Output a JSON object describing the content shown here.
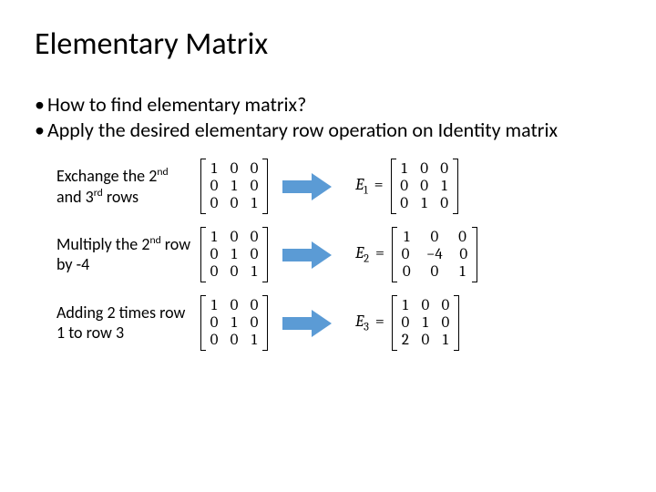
{
  "title": "Elementary Matrix",
  "bullets": [
    "How to find elementary matrix?",
    "Apply the desired elementary row operation on Identity matrix"
  ],
  "examples": [
    {
      "desc_parts": [
        "Exchange the 2",
        "nd",
        " and 3",
        "rd",
        " rows"
      ],
      "identity": [
        [
          "1",
          "0",
          "0"
        ],
        [
          "0",
          "1",
          "0"
        ],
        [
          "0",
          "0",
          "1"
        ]
      ],
      "result_label": {
        "sym": "E",
        "sub": "1"
      },
      "result": [
        [
          "1",
          "0",
          "0"
        ],
        [
          "0",
          "0",
          "1"
        ],
        [
          "0",
          "1",
          "0"
        ]
      ],
      "wide": false
    },
    {
      "desc_parts": [
        "Multiply the 2",
        "nd",
        " row by -4"
      ],
      "identity": [
        [
          "1",
          "0",
          "0"
        ],
        [
          "0",
          "1",
          "0"
        ],
        [
          "0",
          "0",
          "1"
        ]
      ],
      "result_label": {
        "sym": "E",
        "sub": "2"
      },
      "result": [
        [
          "1",
          "0",
          "0"
        ],
        [
          "0",
          "−4",
          "0"
        ],
        [
          "0",
          "0",
          "1"
        ]
      ],
      "wide": true
    },
    {
      "desc_parts": [
        "Adding 2 times row 1 to row 3"
      ],
      "identity": [
        [
          "1",
          "0",
          "0"
        ],
        [
          "0",
          "1",
          "0"
        ],
        [
          "0",
          "0",
          "1"
        ]
      ],
      "result_label": {
        "sym": "E",
        "sub": "3"
      },
      "result": [
        [
          "1",
          "0",
          "0"
        ],
        [
          "0",
          "1",
          "0"
        ],
        [
          "2",
          "0",
          "1"
        ]
      ],
      "wide": false
    }
  ],
  "arrow_color": "#5b9bd5"
}
